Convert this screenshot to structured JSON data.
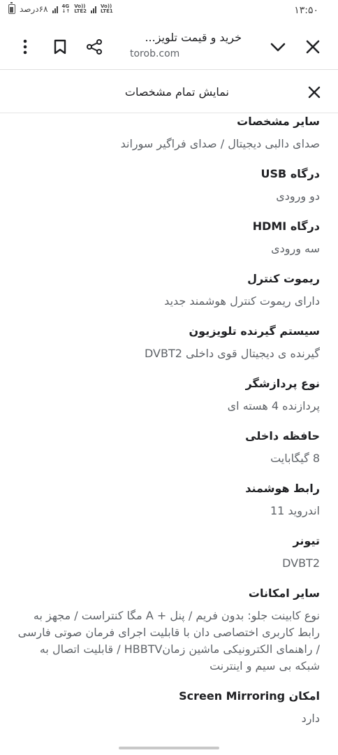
{
  "status_bar": {
    "time": "۱۳:۵۰",
    "battery_text": "۶۸درصد",
    "net1_top": "Vo))",
    "net1_bottom": "LTE1",
    "net2_top": "Vo))",
    "net2_bottom": "LTE2",
    "net3_top": "4G",
    "net3_bottom": "↓↑"
  },
  "browser": {
    "page_title": "خرید و قیمت تلویز...",
    "url": "torob.com",
    "icons": [
      "close-icon",
      "chevron-down-icon",
      "share-icon",
      "bookmark-icon",
      "more-vert-icon"
    ]
  },
  "panel": {
    "title": "نمایش تمام مشخصات"
  },
  "specs": [
    {
      "label": "سایر مشخصات",
      "value": "صدای دالبی دیجیتال / صدای فراگیر سوراند"
    },
    {
      "label": "درگاه USB",
      "value": "دو ورودی"
    },
    {
      "label": "درگاه HDMI",
      "value": "سه ورودی"
    },
    {
      "label": "ریموت کنترل",
      "value": "دارای ریموت کنترل هوشمند جدید"
    },
    {
      "label": "سیستم گیرنده تلویزیون",
      "value": "گیرنده ی دیجیتال قوی داخلی DVBT2"
    },
    {
      "label": "نوع پردازشگر",
      "value": "پردازنده 4 هسته ای"
    },
    {
      "label": "حافظه داخلی",
      "value": "8 گیگابایت"
    },
    {
      "label": "رابط هوشمند",
      "value": "اندروید 11"
    },
    {
      "label": "تیونر",
      "value": "DVBT2"
    },
    {
      "label": "سایر امکانات",
      "value": "نوع کابینت جلو: بدون فریم / پنل + A مگا کنتراست / مجهز به رابط کاربری اختصاصی دان با قابلیت اجرای فرمان صوتی فارسی / راهنمای الکترونیکی ماشین زمانHBBTV / قابلیت اتصال به شبکه بی سیم و اینترنت"
    },
    {
      "label": "امکان Screen Mirroring",
      "value": "دارد"
    }
  ]
}
